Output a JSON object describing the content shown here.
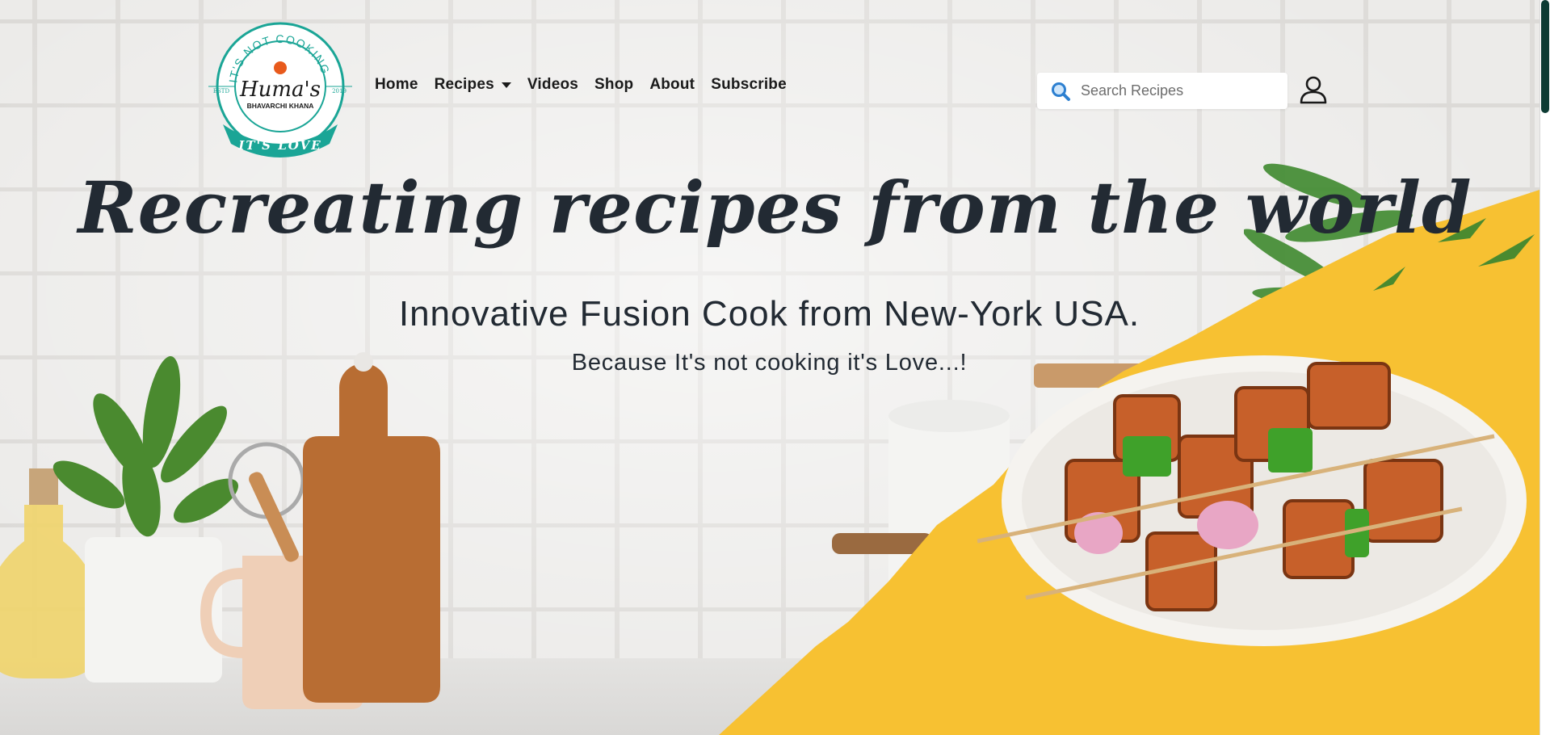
{
  "logo": {
    "top_text": "IT'S NOT COOKING",
    "name": "Huma's",
    "tagline": "BHAVARCHI KHANA",
    "estd": "ESTD",
    "year": "2019",
    "ribbon": "IT'S LOVE"
  },
  "nav": {
    "items": [
      "Home",
      "Recipes",
      "Videos",
      "Shop",
      "About",
      "Subscribe"
    ]
  },
  "search": {
    "placeholder": "Search Recipes",
    "icon": "search-icon"
  },
  "user": {
    "icon": "user-icon"
  },
  "hero": {
    "title": "Recreating recipes from the world",
    "subtitle": "Innovative Fusion Cook from New-York USA.",
    "tagline": "Because It's not cooking it's Love...!"
  },
  "colors": {
    "accent_teal": "#1aa596",
    "yellow": "#f7c132",
    "text_dark": "#222a33",
    "scroll_thumb": "#0d3b33"
  }
}
